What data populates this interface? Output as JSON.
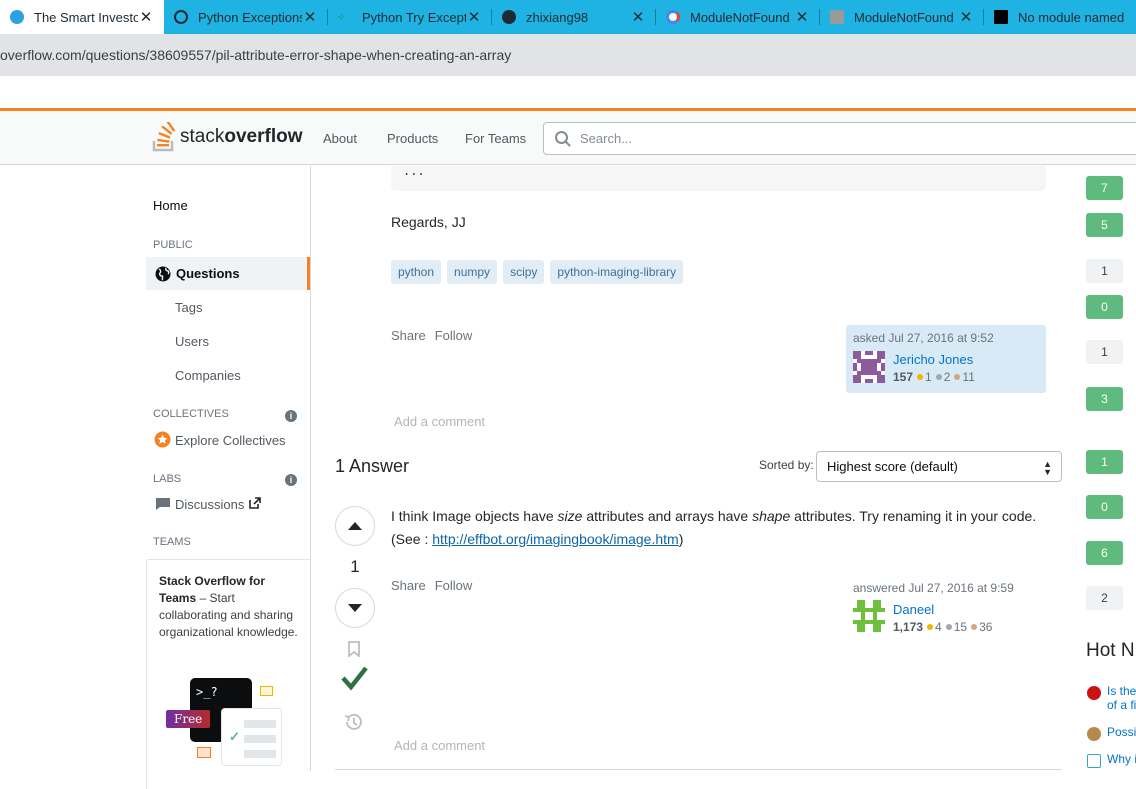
{
  "browser": {
    "tabs": [
      {
        "title": "The Smart Investo",
        "icon": "telegram-icon",
        "color": "#2aa3e0"
      },
      {
        "title": "Python Exceptions",
        "icon": "globe-icon",
        "color": "#1d2a33"
      },
      {
        "title": "Python Try Except",
        "icon": "w3-icon",
        "color": "#04aa6d"
      },
      {
        "title": "zhixiang98",
        "icon": "github-icon",
        "color": "#1d2a33"
      },
      {
        "title": "ModuleNotFound",
        "icon": "google-icon",
        "color": "#4285f4"
      },
      {
        "title": "ModuleNotFound",
        "icon": "site-icon",
        "color": "#777"
      },
      {
        "title": "No module named",
        "icon": "terminal-icon",
        "color": "#000"
      }
    ],
    "url": "overflow.com/questions/38609557/pil-attribute-error-shape-when-creating-an-array"
  },
  "header": {
    "logo_stack": "stack",
    "logo_overflow": "overflow",
    "nav": [
      "About",
      "Products",
      "For Teams"
    ],
    "search_placeholder": "Search..."
  },
  "sidebar": {
    "home": "Home",
    "public_head": "PUBLIC",
    "questions": "Questions",
    "tags": "Tags",
    "users": "Users",
    "companies": "Companies",
    "collectives_head": "COLLECTIVES",
    "explore_collectives": "Explore Collectives",
    "labs_head": "LABS",
    "discussions": "Discussions",
    "teams_head": "TEAMS",
    "teams_title": "Stack Overflow for Teams",
    "teams_text": " – Start collaborating and sharing organizational knowledge.",
    "free_badge": "Free",
    "terminal_prompt": ">_?"
  },
  "question": {
    "code_tail": "...",
    "closing": "Regards, JJ",
    "tags": [
      "python",
      "numpy",
      "scipy",
      "python-imaging-library"
    ],
    "share": "Share",
    "follow": "Follow",
    "asked": "asked Jul 27, 2016 at 9:52",
    "user": "Jericho Jones",
    "rep": "157",
    "gold": "1",
    "silver": "2",
    "bronze": "11",
    "add_comment": "Add a comment"
  },
  "answers": {
    "heading": "1 Answer",
    "sorted_by": "Sorted by:",
    "sort_value": "Highest score (default)",
    "items": [
      {
        "score": "1",
        "body_pre1": "I think Image objects have ",
        "body_em1": "size",
        "body_mid": " attributes and arrays have ",
        "body_em2": "shape",
        "body_post": " attributes. Try renaming it in your code. (See : ",
        "link": "http://effbot.org/imagingbook/image.htm",
        "body_end": ")",
        "share": "Share",
        "follow": "Follow",
        "answered": "answered Jul 27, 2016 at 9:59",
        "user": "Daneel",
        "rep": "1,173",
        "gold": "4",
        "silver": "15",
        "bronze": "36",
        "add_comment": "Add a comment",
        "accepted": true
      }
    ]
  },
  "related_scores": [
    "7",
    "5",
    "1",
    "0",
    "1",
    "3",
    "1",
    "0",
    "6",
    "2"
  ],
  "hot_network": {
    "heading": "Hot N",
    "items": [
      "Is the",
      "of a fi",
      "Possi",
      "Why i"
    ]
  }
}
